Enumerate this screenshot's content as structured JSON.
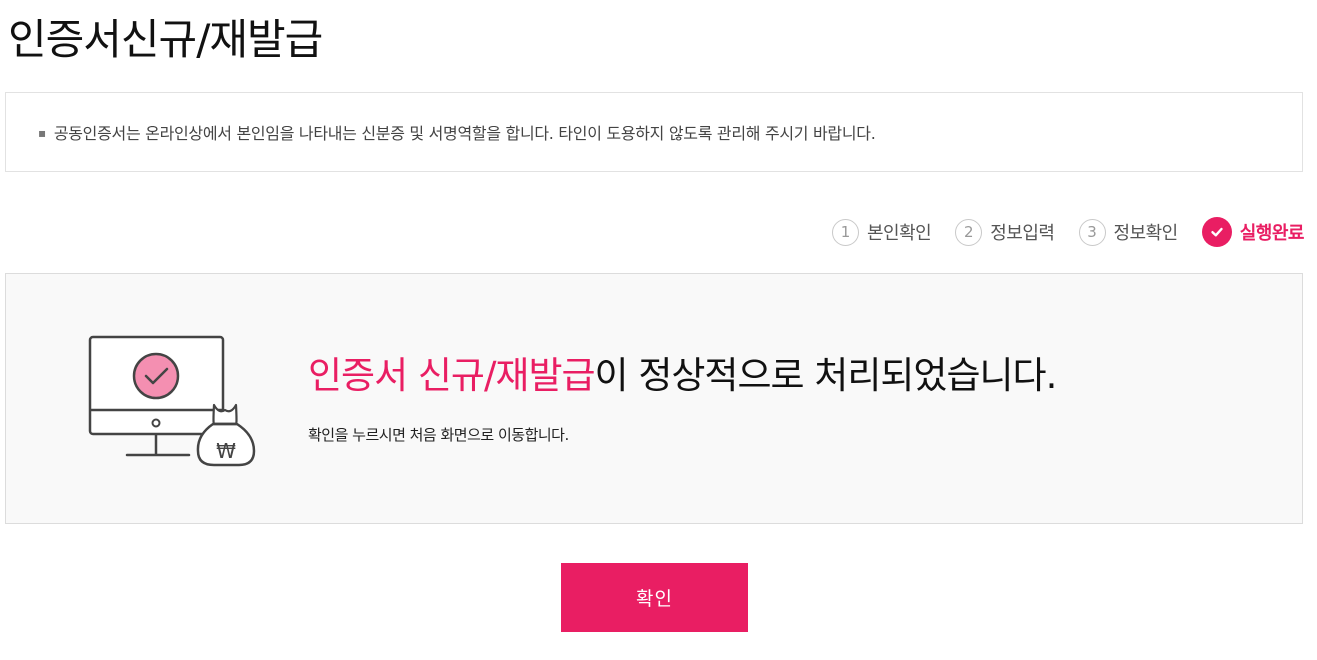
{
  "page": {
    "title": "인증서신규/재발급"
  },
  "notice": {
    "bullet": "▪",
    "text": "공동인증서는 온라인상에서 본인임을 나타내는 신분증 및 서명역할을 합니다. 타인이 도용하지 않도록 관리해 주시기 바랍니다."
  },
  "steps": [
    {
      "number": "1",
      "label": "본인확인",
      "state": "done"
    },
    {
      "number": "2",
      "label": "정보입력",
      "state": "done"
    },
    {
      "number": "3",
      "label": "정보확인",
      "state": "done"
    },
    {
      "number": "",
      "label": "실행완료",
      "state": "active",
      "icon": "check-icon"
    }
  ],
  "result": {
    "title_highlight": "인증서 신규/재발급",
    "title_rest": "이 정상적으로 처리되었습니다.",
    "subtitle": "확인을 누르시면 처음 화면으로 이동합니다.",
    "illustration_icons": [
      "monitor-icon",
      "check-icon",
      "money-bag-icon"
    ],
    "money_bag_symbol": "₩"
  },
  "actions": {
    "confirm_label": "확인"
  },
  "colors": {
    "accent": "#e91e63",
    "text": "#111111",
    "muted": "#555555",
    "box_bg": "#f9f9f9",
    "border": "#dcdcdc"
  }
}
